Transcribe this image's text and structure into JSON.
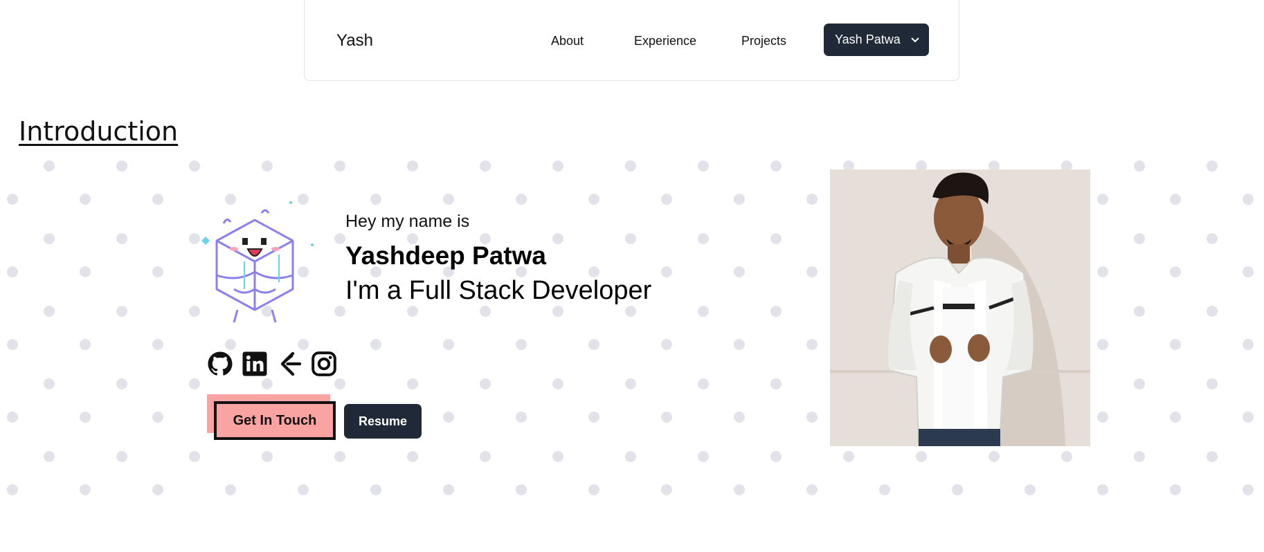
{
  "nav": {
    "brand": "Yash",
    "links": [
      "About",
      "Experience",
      "Projects"
    ],
    "dropdown_label": "Yash Patwa"
  },
  "section": {
    "title": "Introduction"
  },
  "hero": {
    "greeting": "Hey my name is",
    "name": "Yashdeep Patwa",
    "role": "I'm a Full Stack Developer"
  },
  "socials": [
    "github-icon",
    "linkedin-icon",
    "leetcode-icon",
    "instagram-icon"
  ],
  "buttons": {
    "contact": "Get In Touch",
    "resume": "Resume"
  },
  "colors": {
    "dark": "#1f2937",
    "accent_pink": "#f9a3a3",
    "dot": "#e2e3ea",
    "mascot": "#8b80f0"
  }
}
